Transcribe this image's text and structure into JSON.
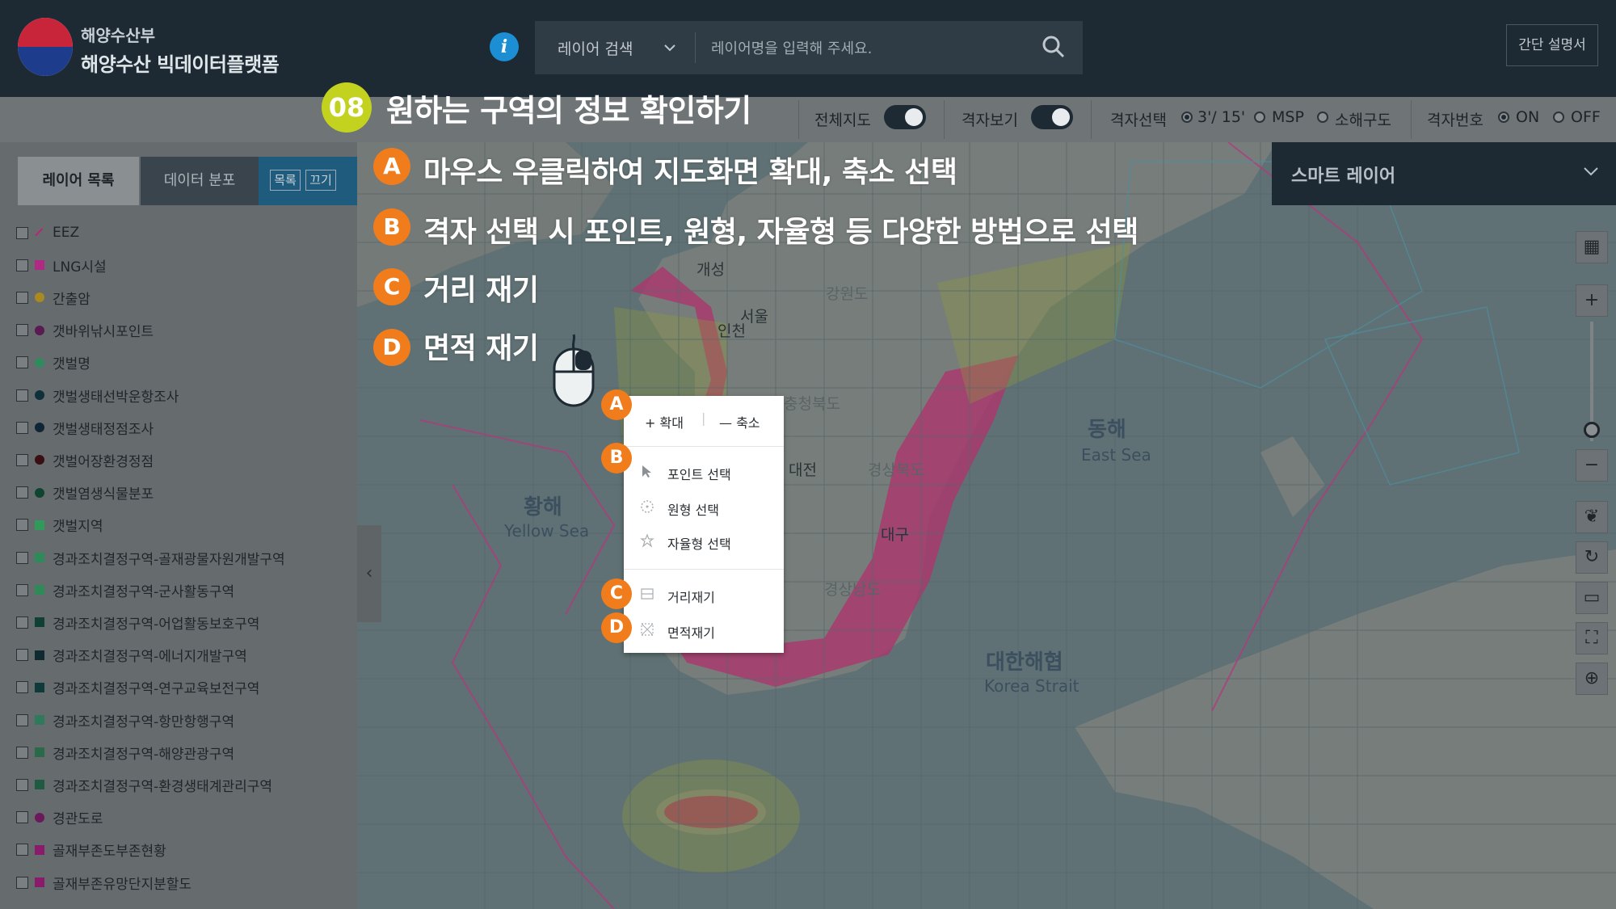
{
  "header": {
    "org_name": "해양수산부",
    "platform_name": "해양수산 빅데이터플랫폼",
    "search_type": "레이어 검색",
    "search_placeholder": "레이어명을 입력해 주세요.",
    "manual_label": "간단 설명서"
  },
  "toolbar": {
    "full_map_label": "전체지도",
    "grid_view_label": "격자보기",
    "grid_select_label": "격자선택",
    "grid_options": [
      "3'/ 15'",
      "MSP",
      "소해구도"
    ],
    "grid_number_label": "격자번호",
    "grid_number_options": [
      "ON",
      "OFF"
    ]
  },
  "left_panel": {
    "tabs": [
      "레이어 목록",
      "데이터 분포"
    ],
    "list_button": "목록",
    "off_button": "끄기",
    "layers": [
      {
        "label": "EEZ",
        "color": "#c0207a"
      },
      {
        "label": "LNG시설",
        "color": "#b02a84"
      },
      {
        "label": "간출암",
        "color": "#a88a20"
      },
      {
        "label": "갯바위낚시포인트",
        "color": "#5a1a52"
      },
      {
        "label": "갯벌명",
        "color": "#2f8a5e"
      },
      {
        "label": "갯벌생태선박운항조사",
        "color": "#0f2f3a"
      },
      {
        "label": "갯벌생태정점조사",
        "color": "#0f2533"
      },
      {
        "label": "갯벌어장환경정점",
        "color": "#3a0f14"
      },
      {
        "label": "갯벌염생식물분포",
        "color": "#0f4530"
      },
      {
        "label": "갯벌지역",
        "color": "#2f9a5a"
      },
      {
        "label": "경과조치결정구역-골재광물자원개발구역",
        "color": "#2f8a5a"
      },
      {
        "label": "경과조치결정구역-군사활동구역",
        "color": "#2f8a5a"
      },
      {
        "label": "경과조치결정구역-어업활동보호구역",
        "color": "#0f4032"
      },
      {
        "label": "경과조치결정구역-에너지개발구역",
        "color": "#0f2a30"
      },
      {
        "label": "경과조치결정구역-연구교육보전구역",
        "color": "#0f3a3a"
      },
      {
        "label": "경과조치결정구역-항만항행구역",
        "color": "#2f7a5a"
      },
      {
        "label": "경과조치결정구역-해양관광구역",
        "color": "#2a6a4a"
      },
      {
        "label": "경과조치결정구역-환경생태계관리구역",
        "color": "#1f5a42"
      },
      {
        "label": "경관도로",
        "color": "#6a1a5a"
      },
      {
        "label": "골재부존도부존현황",
        "color": "#8a1a6a"
      },
      {
        "label": "골재부존유망단지분할도",
        "color": "#8a1a6a"
      }
    ]
  },
  "smart_layer": {
    "title": "스마트 레이어"
  },
  "map": {
    "labels": [
      "개성",
      "서울",
      "인천",
      "강원도",
      "충청북도",
      "경상북도",
      "대구",
      "경상남도",
      "동해",
      "East Sea",
      "대한해협",
      "Korea Strait",
      "황해",
      "Yellow Sea",
      "대전"
    ]
  },
  "context_menu": {
    "zoom_in": "+ 확대",
    "zoom_out": "— 축소",
    "point_select": "포인트 선택",
    "circle_select": "원형 선택",
    "free_select": "자율형 선택",
    "distance": "거리재기",
    "area": "면적재기"
  },
  "overlay": {
    "step_number": "08",
    "step_title": "원하는 구역의 정보 확인하기",
    "items": [
      {
        "badge": "A",
        "text": "마우스 우클릭하여 지도화면 확대, 축소 선택"
      },
      {
        "badge": "B",
        "text": "격자 선택 시 포인트, 원형, 자율형 등 다양한 방법으로 선택"
      },
      {
        "badge": "C",
        "text": "거리 재기"
      },
      {
        "badge": "D",
        "text": "면적 재기"
      }
    ]
  },
  "colors": {
    "header_bg": "#1e2a33",
    "toolbar_bg": "#6f7476",
    "step_badge": "#c3d21f",
    "annotation_badge": "#f07c1c",
    "map_sea": "#5f7174",
    "map_land": "#767c7a"
  }
}
